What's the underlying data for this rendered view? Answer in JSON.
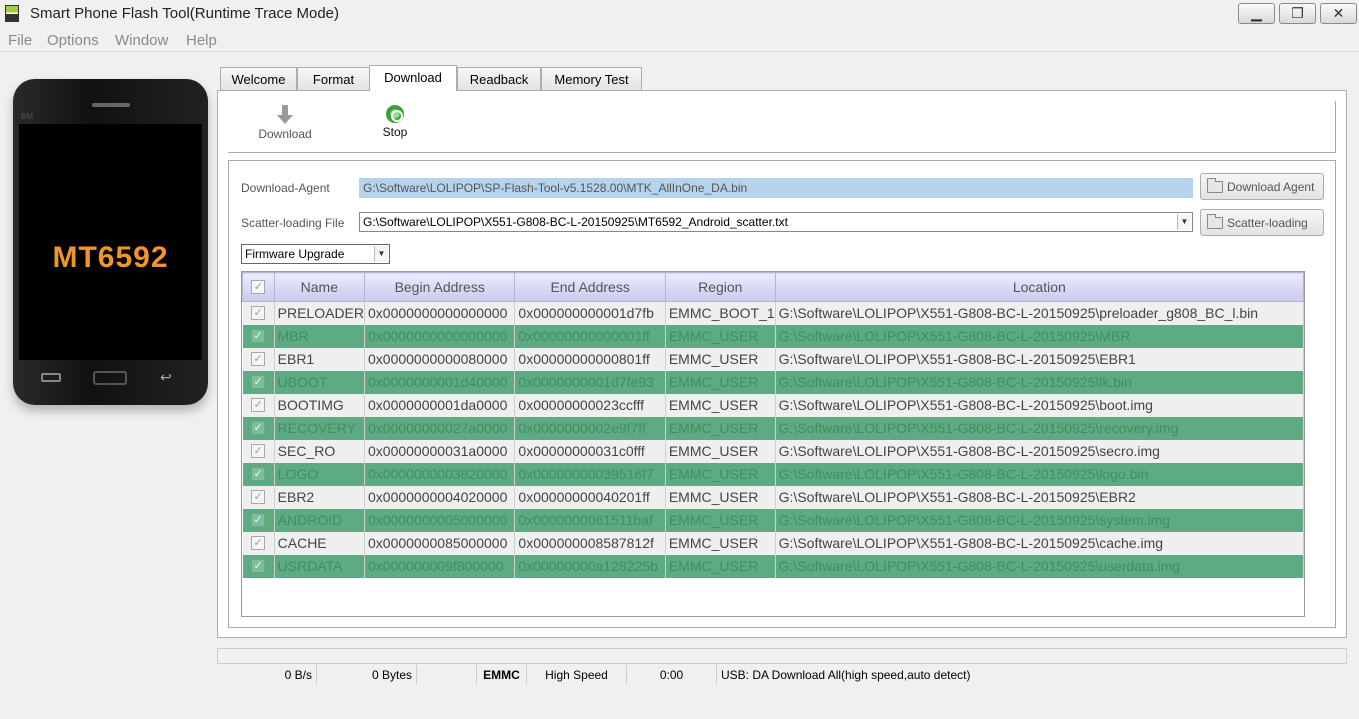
{
  "window": {
    "title": "Smart Phone Flash Tool(Runtime Trace Mode)"
  },
  "menu": [
    "File",
    "Options",
    "Window",
    "Help"
  ],
  "phone": {
    "brand": "BM",
    "chip_label": "MT6592"
  },
  "tabs": [
    "Welcome",
    "Format",
    "Download",
    "Readback",
    "Memory Test"
  ],
  "active_tab": "Download",
  "toolbar": {
    "download_label": "Download",
    "stop_label": "Stop"
  },
  "download_agent": {
    "label": "Download-Agent",
    "value": "G:\\Software\\LOLIPOP\\SP-Flash-Tool-v5.1528.00\\MTK_AllInOne_DA.bin",
    "button_label": "Download Agent"
  },
  "scatter": {
    "label": "Scatter-loading File",
    "value": "G:\\Software\\LOLIPOP\\X551-G808-BC-L-20150925\\MT6592_Android_scatter.txt",
    "button_label": "Scatter-loading"
  },
  "mode_select": {
    "value": "Firmware Upgrade"
  },
  "table": {
    "columns": [
      "",
      "Name",
      "Begin Address",
      "End Address",
      "Region",
      "Location"
    ],
    "rows": [
      {
        "checked": "✓",
        "name": "PRELOADER",
        "begin": "0x0000000000000000",
        "end": "0x000000000001d7fb",
        "region": "EMMC_BOOT_1",
        "location": "G:\\Software\\LOLIPOP\\X551-G808-BC-L-20150925\\preloader_g808_BC_l.bin"
      },
      {
        "checked": "✓",
        "name": "MBR",
        "begin": "0x0000000000000000",
        "end": "0x00000000000001ff",
        "region": "EMMC_USER",
        "location": "G:\\Software\\LOLIPOP\\X551-G808-BC-L-20150925\\MBR"
      },
      {
        "checked": "✓",
        "name": "EBR1",
        "begin": "0x0000000000080000",
        "end": "0x00000000000801ff",
        "region": "EMMC_USER",
        "location": "G:\\Software\\LOLIPOP\\X551-G808-BC-L-20150925\\EBR1"
      },
      {
        "checked": "✓",
        "name": "UBOOT",
        "begin": "0x0000000001d40000",
        "end": "0x0000000001d7fe93",
        "region": "EMMC_USER",
        "location": "G:\\Software\\LOLIPOP\\X551-G808-BC-L-20150925\\lk.bin"
      },
      {
        "checked": "✓",
        "name": "BOOTIMG",
        "begin": "0x0000000001da0000",
        "end": "0x00000000023ccfff",
        "region": "EMMC_USER",
        "location": "G:\\Software\\LOLIPOP\\X551-G808-BC-L-20150925\\boot.img"
      },
      {
        "checked": "✓",
        "name": "RECOVERY",
        "begin": "0x00000000027a0000",
        "end": "0x0000000002e9f7ff",
        "region": "EMMC_USER",
        "location": "G:\\Software\\LOLIPOP\\X551-G808-BC-L-20150925\\recovery.img"
      },
      {
        "checked": "✓",
        "name": "SEC_RO",
        "begin": "0x00000000031a0000",
        "end": "0x00000000031c0fff",
        "region": "EMMC_USER",
        "location": "G:\\Software\\LOLIPOP\\X551-G808-BC-L-20150925\\secro.img"
      },
      {
        "checked": "✓",
        "name": "LOGO",
        "begin": "0x0000000003820000",
        "end": "0x00000000039516f7",
        "region": "EMMC_USER",
        "location": "G:\\Software\\LOLIPOP\\X551-G808-BC-L-20150925\\logo.bin"
      },
      {
        "checked": "✓",
        "name": "EBR2",
        "begin": "0x0000000004020000",
        "end": "0x00000000040201ff",
        "region": "EMMC_USER",
        "location": "G:\\Software\\LOLIPOP\\X551-G808-BC-L-20150925\\EBR2"
      },
      {
        "checked": "✓",
        "name": "ANDROID",
        "begin": "0x0000000005000000",
        "end": "0x0000000061511baf",
        "region": "EMMC_USER",
        "location": "G:\\Software\\LOLIPOP\\X551-G808-BC-L-20150925\\system.img"
      },
      {
        "checked": "✓",
        "name": "CACHE",
        "begin": "0x0000000085000000",
        "end": "0x000000008587812f",
        "region": "EMMC_USER",
        "location": "G:\\Software\\LOLIPOP\\X551-G808-BC-L-20150925\\cache.img"
      },
      {
        "checked": "✓",
        "name": "USRDATA",
        "begin": "0x000000009f800000",
        "end": "0x00000000a128225b",
        "region": "EMMC_USER",
        "location": "G:\\Software\\LOLIPOP\\X551-G808-BC-L-20150925\\userdata.img"
      }
    ]
  },
  "status": {
    "speed": "0 B/s",
    "bytes": "0 Bytes",
    "storage": "EMMC",
    "mode": "High Speed",
    "time": "0:00",
    "usb": "USB: DA Download All(high speed,auto detect)"
  },
  "colors": {
    "row_highlight": "#5eaa82",
    "row_normal": "#efefef",
    "header": "#c9c9ec",
    "agent_field": "#b6d3ee"
  }
}
